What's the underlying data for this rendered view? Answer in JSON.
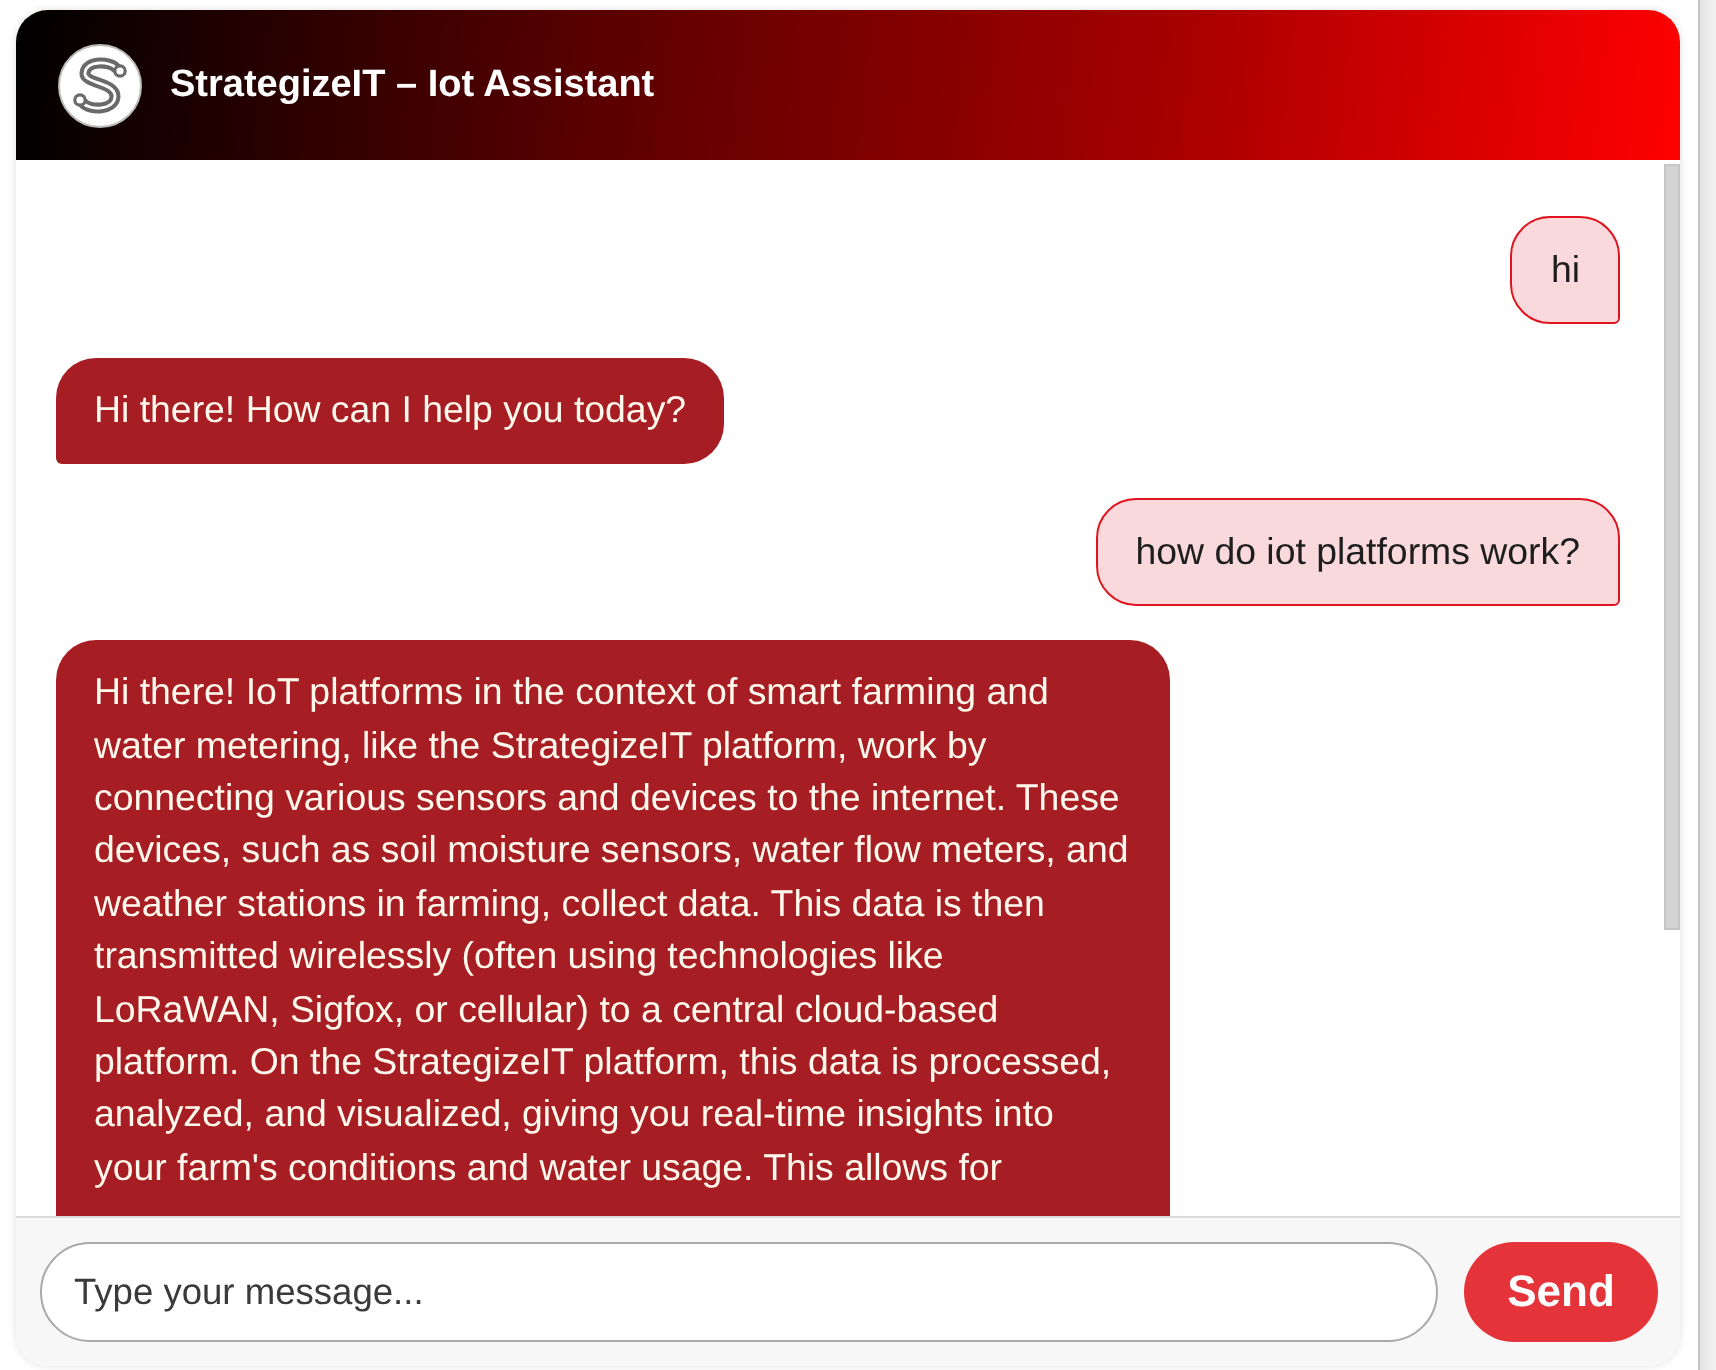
{
  "header": {
    "title": "StrategizeIT – Iot Assistant"
  },
  "messages": [
    {
      "kind": "user",
      "text": "hi"
    },
    {
      "kind": "bot",
      "text": "Hi there! How can I help you today?"
    },
    {
      "kind": "user",
      "text": "how do iot platforms work?"
    },
    {
      "kind": "bot",
      "text": "Hi there! IoT platforms in the context of smart farming and water metering, like the StrategizeIT platform, work by connecting various sensors and devices to the internet. These devices, such as soil moisture sensors, water flow meters, and weather stations in farming, collect data. This data is then transmitted wirelessly (often using technologies like LoRaWAN, Sigfox, or cellular) to a central cloud-based platform. On the StrategizeIT platform, this data is processed, analyzed, and visualized, giving you real-time insights into your farm's conditions and water usage. This allows for"
    }
  ],
  "composer": {
    "placeholder": "Type your message...",
    "send_button": "Send"
  }
}
